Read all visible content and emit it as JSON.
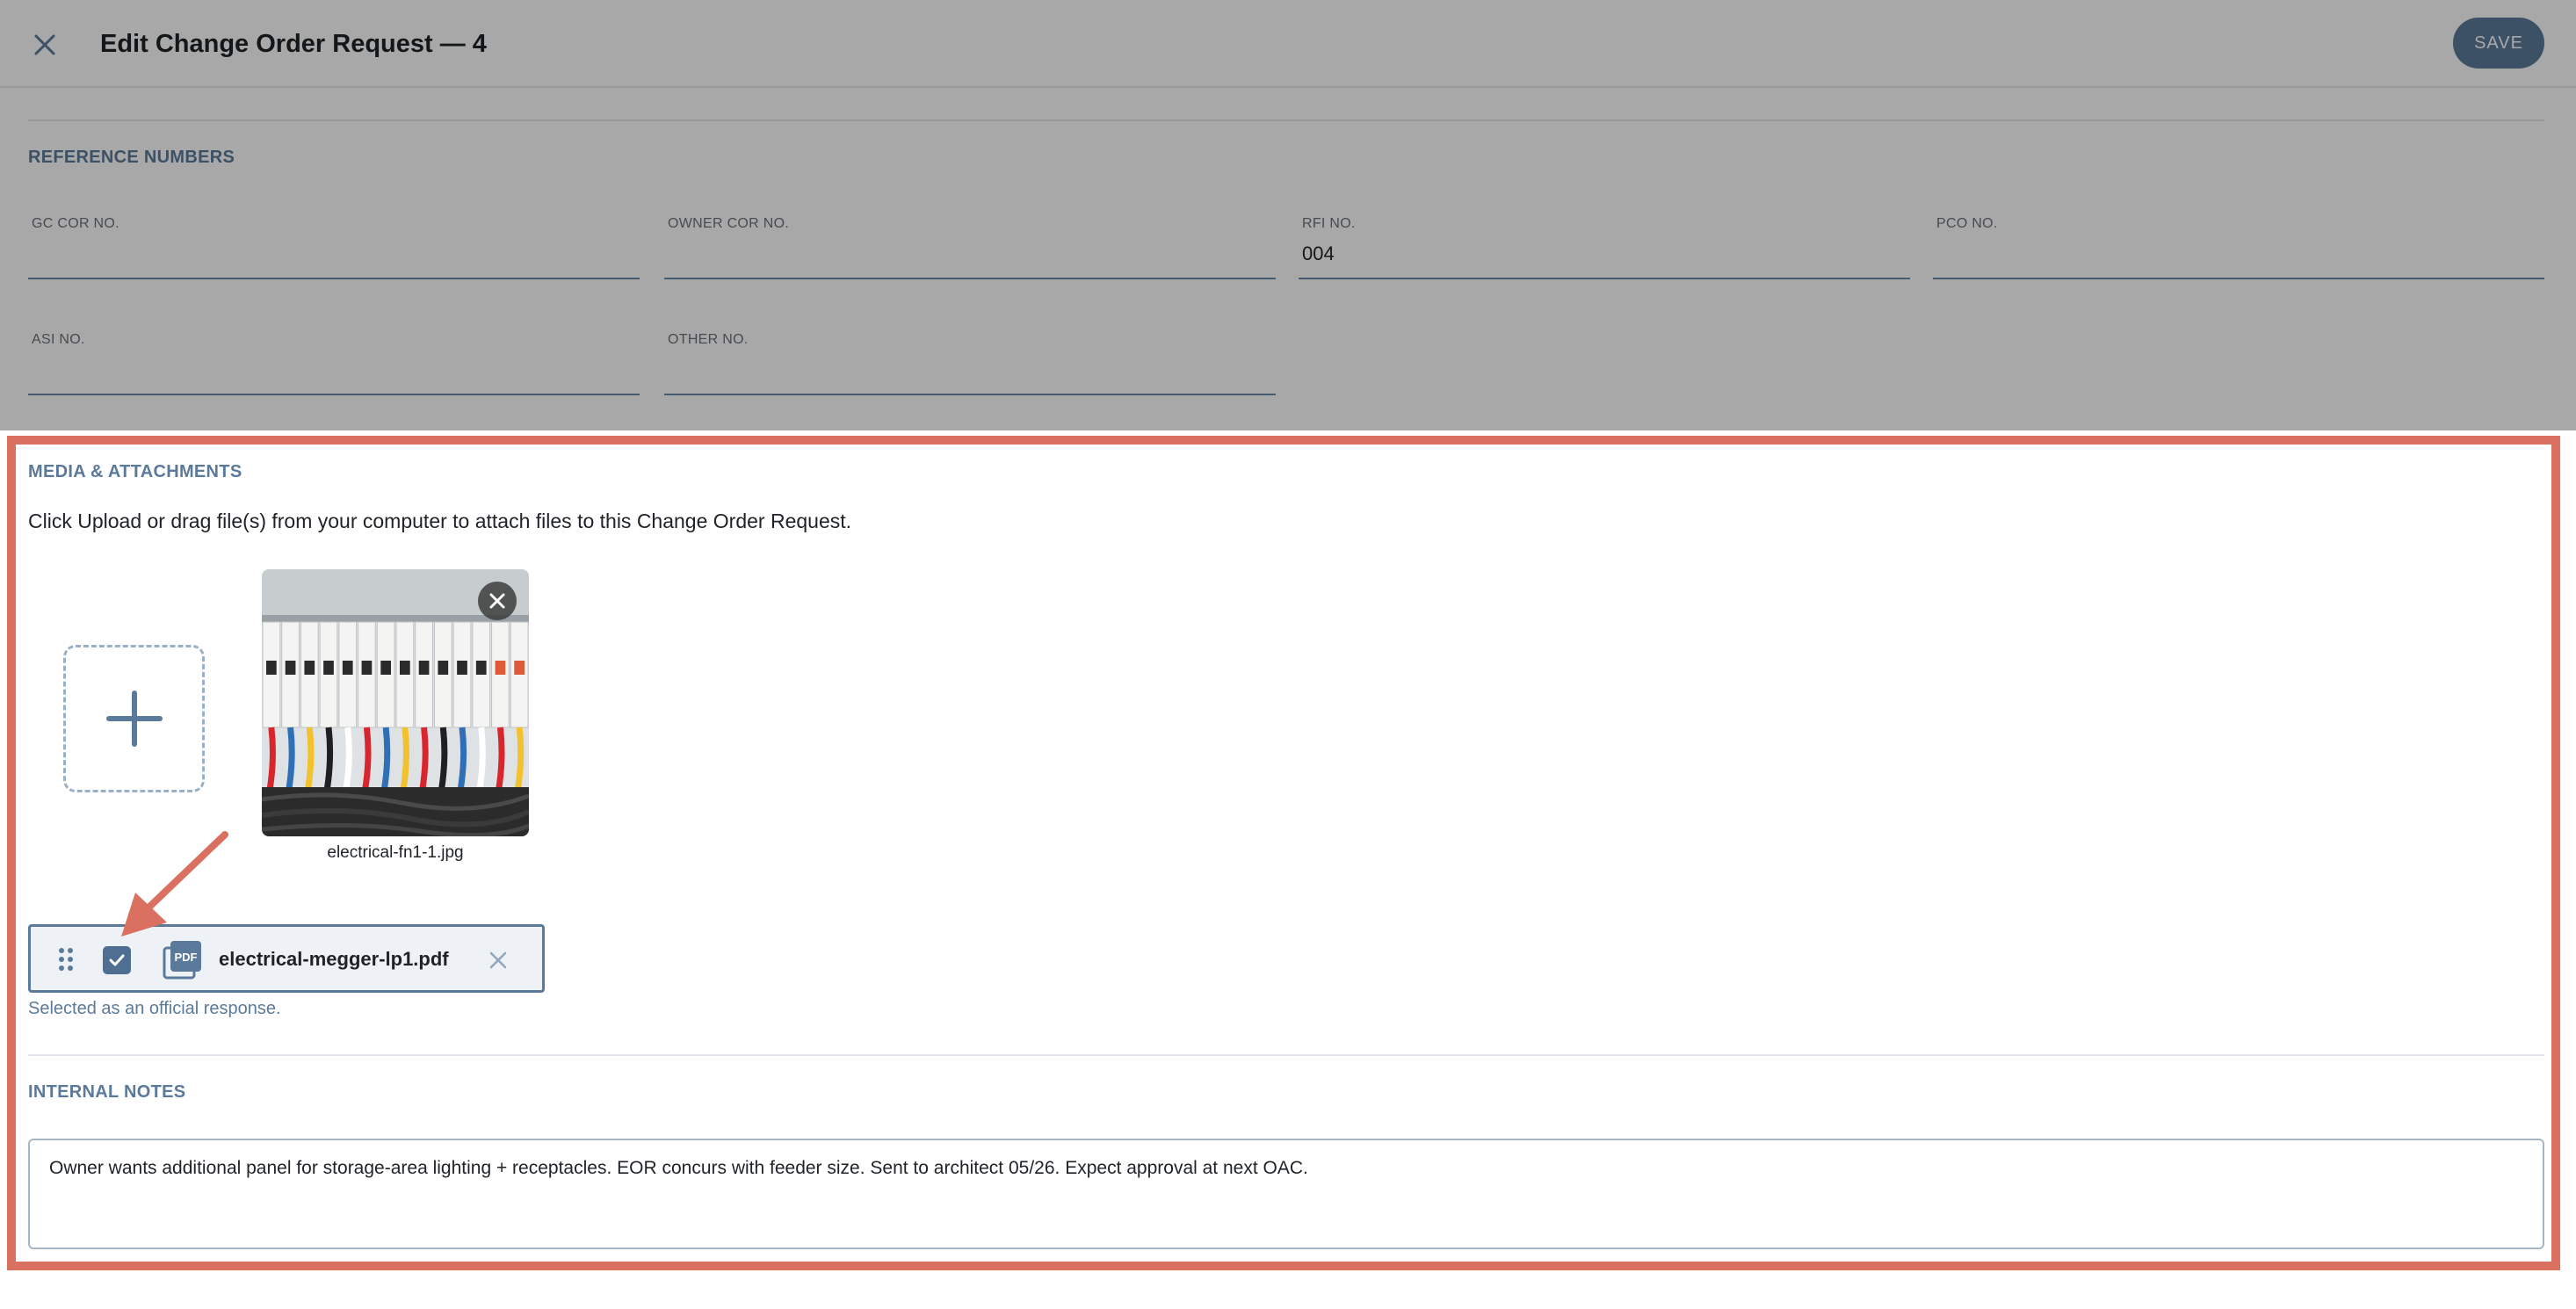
{
  "header": {
    "title": "Edit Change Order Request — 4",
    "save_label": "SAVE"
  },
  "reference_numbers": {
    "section_label": "REFERENCE NUMBERS",
    "fields": [
      {
        "label": "GC COR NO.",
        "value": ""
      },
      {
        "label": "OWNER COR NO.",
        "value": ""
      },
      {
        "label": "RFI NO.",
        "value": "004"
      },
      {
        "label": "PCO NO.",
        "value": ""
      },
      {
        "label": "ASI NO.",
        "value": ""
      },
      {
        "label": "OTHER NO.",
        "value": ""
      }
    ]
  },
  "media": {
    "section_label": "MEDIA & ATTACHMENTS",
    "instruction": "Click Upload or drag file(s) from your computer to attach files to this Change Order Request.",
    "image_attachment": {
      "filename": "electrical-fn1-1.jpg"
    },
    "file_attachment": {
      "filename": "electrical-megger-lp1.pdf",
      "icon_label": "PDF",
      "checked": true,
      "status": "Selected as an official response."
    }
  },
  "internal_notes": {
    "section_label": "INTERNAL NOTES",
    "text": "Owner wants additional panel for storage-area lighting + receptacles. EOR concurs with feeder size. Sent to architect 05/26. Expect approval at next OAC."
  },
  "colors": {
    "accent": "#5b7a9b",
    "highlight_border": "#d97060",
    "checkbox_fill": "#4e6f92"
  }
}
